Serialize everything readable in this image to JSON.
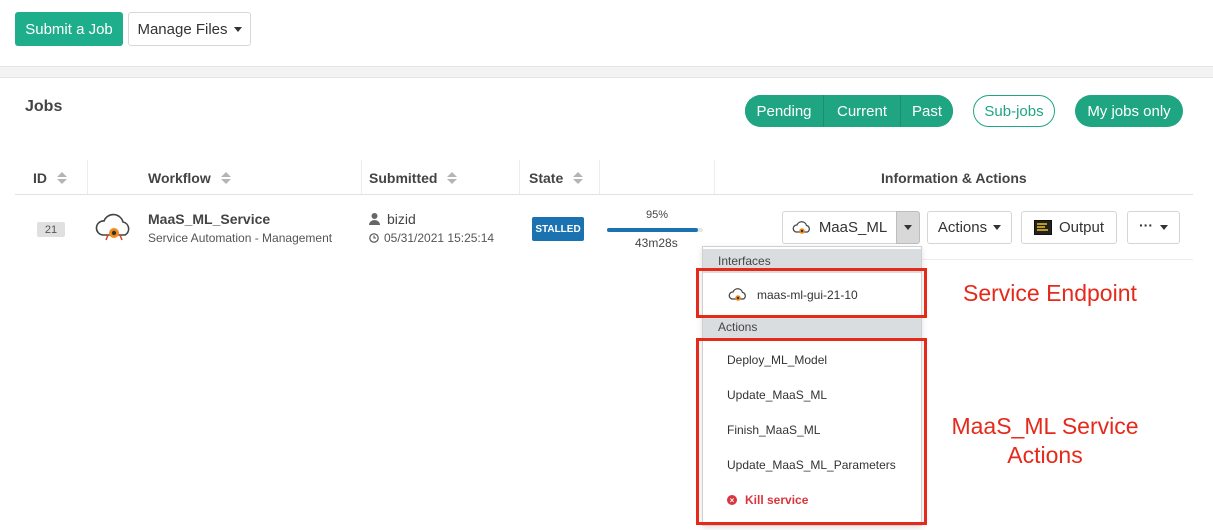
{
  "toolbar": {
    "submit_label": "Submit a Job",
    "manage_files_label": "Manage Files"
  },
  "jobs": {
    "title": "Jobs",
    "filters": [
      "Pending",
      "Current",
      "Past"
    ],
    "subjobs_label": "Sub-jobs",
    "my_jobs_label": "My jobs only"
  },
  "table": {
    "headers": {
      "id": "ID",
      "workflow": "Workflow",
      "submitted": "Submitted",
      "state": "State",
      "info": "Information & Actions"
    },
    "row": {
      "id": "21",
      "workflow_name": "MaaS_ML_Service",
      "workflow_bucket": "Service Automation - Management",
      "user": "bizid",
      "date": "05/31/2021 15:25:14",
      "state": "STALLED",
      "progress_label": "95%",
      "progress_fraction": 0.95,
      "duration": "43m28s",
      "service_label": "MaaS_ML",
      "actions_label": "Actions",
      "output_label": "Output"
    }
  },
  "dropdown": {
    "interfaces_header": "Interfaces",
    "endpoint": "maas-ml-gui-21-10",
    "actions_header": "Actions",
    "actions": [
      "Deploy_ML_Model",
      "Update_MaaS_ML",
      "Finish_MaaS_ML",
      "Update_MaaS_ML_Parameters"
    ],
    "kill_label": "Kill service"
  },
  "annotations": {
    "endpoint_label": "Service Endpoint",
    "actions_label_line1": "MaaS_ML Service",
    "actions_label_line2": "Actions"
  },
  "colors": {
    "primary": "#1fae8b",
    "state": "#1a73b0",
    "annotation": "#e5291a",
    "kill": "#d9353e"
  },
  "icons": [
    "caret-down-icon",
    "sort-icon",
    "service-cloud-icon",
    "user-icon",
    "clock-icon",
    "output-terminal-icon",
    "more-dots-icon",
    "kill-circle-icon"
  ]
}
